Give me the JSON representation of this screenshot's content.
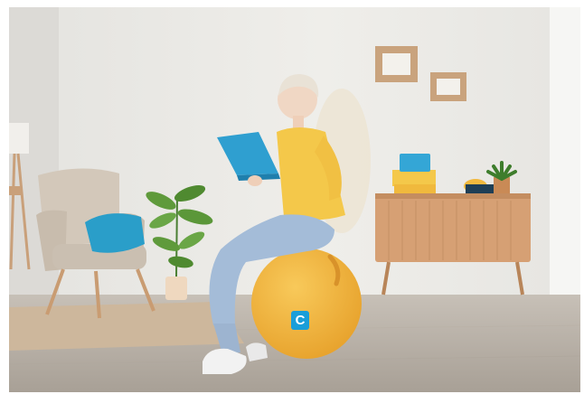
{
  "photo": {
    "subject": "woman-reading-on-yellow-exercise-ball",
    "colors": {
      "wall": "#ecebe7",
      "floor": "#b6aea4",
      "ball": "#f2b43a",
      "sweater": "#f4c84a",
      "book": "#2f9fd0",
      "jeans": "#9fb8d6",
      "armchair": "#cfc4b6",
      "cushion": "#2a9ec9",
      "sideboard": "#d6a074"
    }
  },
  "badge": {
    "label": "C",
    "color": "#1a9ed9"
  }
}
